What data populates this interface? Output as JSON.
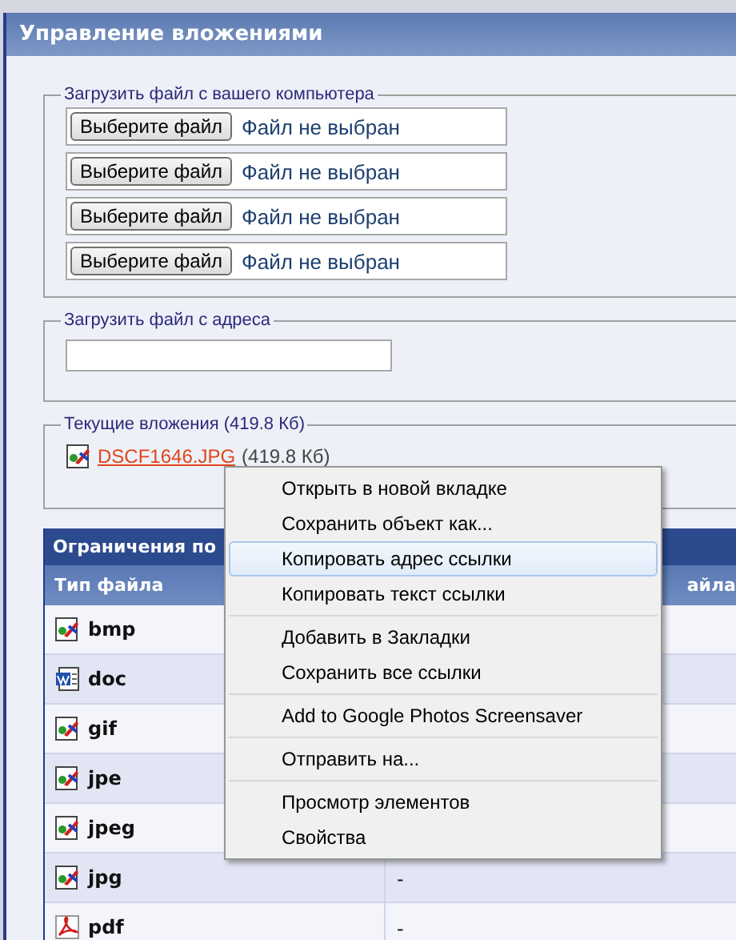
{
  "panel": {
    "title": "Управление вложениями"
  },
  "upload_local": {
    "legend": "Загрузить файл с вашего компьютера",
    "inputs": [
      {
        "button": "Выберите файл",
        "status": "Файл не выбран"
      },
      {
        "button": "Выберите файл",
        "status": "Файл не выбран"
      },
      {
        "button": "Выберите файл",
        "status": "Файл не выбран"
      },
      {
        "button": "Выберите файл",
        "status": "Файл не выбран"
      }
    ]
  },
  "upload_url": {
    "legend": "Загрузить файл с адреса"
  },
  "current": {
    "legend": "Текущие вложения (419.8 Кб)",
    "files": [
      {
        "kind": "image",
        "name": "DSCF1646.JPG",
        "size": "(419.8 Кб)"
      }
    ]
  },
  "limits_table": {
    "title": "Ограничения по",
    "columns": [
      "Тип файла",
      "айла"
    ],
    "rows": [
      {
        "kind": "image",
        "type": "bmp",
        "column_2": ""
      },
      {
        "kind": "word",
        "type": "doc",
        "column_2": ""
      },
      {
        "kind": "image",
        "type": "gif",
        "column_2": ""
      },
      {
        "kind": "image",
        "type": "jpe",
        "column_2": ""
      },
      {
        "kind": "image",
        "type": "jpeg",
        "column_2": ""
      },
      {
        "kind": "image",
        "type": "jpg",
        "column_2": "-"
      },
      {
        "kind": "pdf",
        "type": "pdf",
        "column_2": "-"
      }
    ]
  },
  "context_menu": {
    "groups": [
      [
        {
          "label": "Открыть в новой вкладке",
          "selected": false
        },
        {
          "label": "Сохранить объект как...",
          "selected": false
        },
        {
          "label": "Копировать адрес ссылки",
          "selected": true
        },
        {
          "label": "Копировать текст ссылки",
          "selected": false
        }
      ],
      [
        {
          "label": "Добавить в Закладки",
          "selected": false
        },
        {
          "label": "Сохранить все ссылки",
          "selected": false
        }
      ],
      [
        {
          "label": "Add to Google Photos Screensaver",
          "selected": false
        }
      ],
      [
        {
          "label": "Отправить на...",
          "selected": false
        }
      ],
      [
        {
          "label": "Просмотр элементов",
          "selected": false
        },
        {
          "label": "Свойства",
          "selected": false
        }
      ]
    ]
  }
}
